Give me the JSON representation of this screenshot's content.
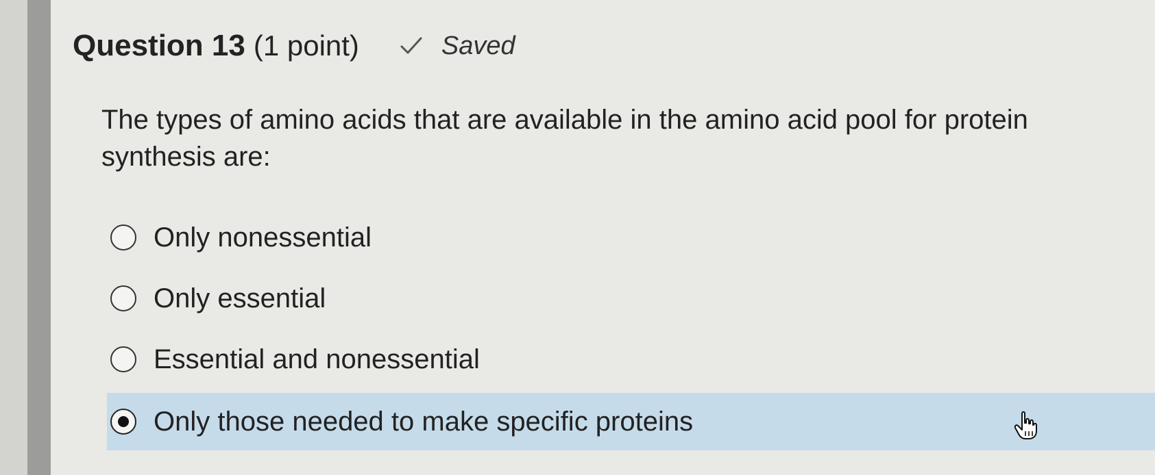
{
  "question": {
    "title": "Question 13",
    "points": "(1 point)",
    "status": "Saved",
    "status_icon": "check-icon",
    "prompt": "The types of amino acids that are available in the amino acid pool for protein synthesis are:"
  },
  "options": [
    {
      "label": "Only nonessential",
      "selected": false
    },
    {
      "label": "Only essential",
      "selected": false
    },
    {
      "label": "Essential and nonessential",
      "selected": false
    },
    {
      "label": "Only those needed to make specific proteins",
      "selected": true
    }
  ],
  "colors": {
    "selected_background": "#c5dbea",
    "left_bar": "#9c9c9a",
    "page_background": "#e9e9e6"
  },
  "cursor": {
    "icon": "hand-pointer-icon"
  }
}
